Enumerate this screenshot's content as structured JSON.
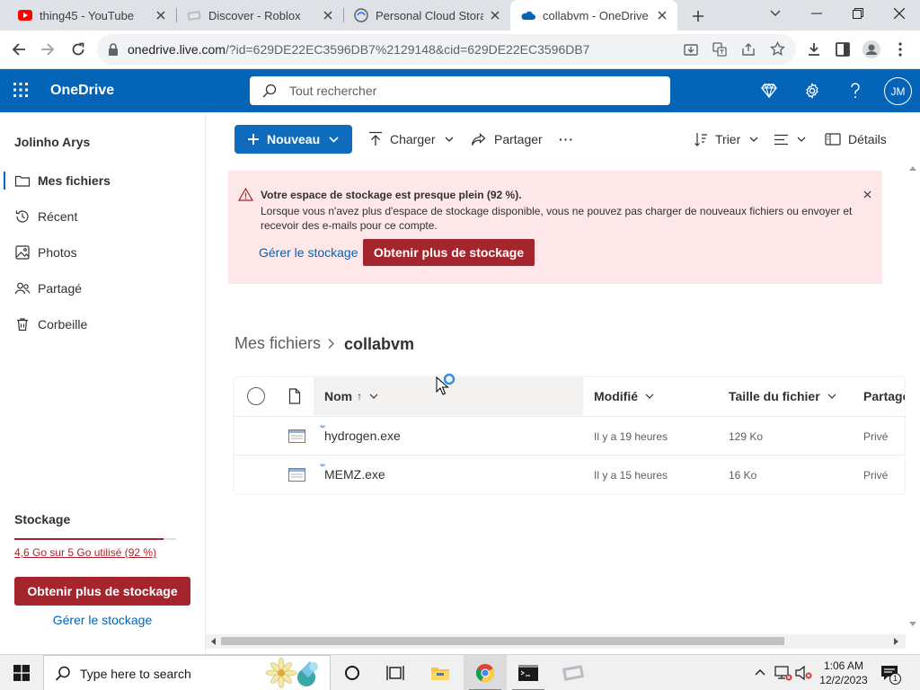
{
  "browser": {
    "tabs": [
      {
        "title": "thing45 - YouTube",
        "icon": "youtube-icon",
        "active": false
      },
      {
        "title": "Discover - Roblox",
        "icon": "roblox-icon",
        "active": false
      },
      {
        "title": "Personal Cloud Storage",
        "icon": "cloud-storage-site-icon",
        "active": false
      },
      {
        "title": "collabvm - OneDrive",
        "icon": "onedrive-icon",
        "active": true
      }
    ],
    "new_tab_icon": "plus-icon",
    "url": "onedrive.live.com/?id=629DE22EC3596DB7%2129148&cid=629DE22EC3596DB7",
    "url_host": "onedrive.live.com",
    "url_rest": "/?id=629DE22EC3596DB7%2129148&cid=629DE22EC3596DB7"
  },
  "app": {
    "name": "OneDrive",
    "search_placeholder": "Tout rechercher",
    "avatar_initials": "JM",
    "brand_color": "#0364b8"
  },
  "sidebar": {
    "user_name": "Jolinho Arys",
    "items": [
      {
        "label": "Mes fichiers",
        "icon": "folder-icon",
        "selected": true
      },
      {
        "label": "Récent",
        "icon": "history-icon",
        "selected": false
      },
      {
        "label": "Photos",
        "icon": "photo-icon",
        "selected": false
      },
      {
        "label": "Partagé",
        "icon": "people-icon",
        "selected": false
      },
      {
        "label": "Corbeille",
        "icon": "recycle-bin-icon",
        "selected": false
      }
    ],
    "storage": {
      "title": "Stockage",
      "usage_text": "4,6 Go sur 5 Go utilisé (92 %)",
      "used_fraction": 0.92,
      "upgrade_label": "Obtenir plus de stockage",
      "manage_label": "Gérer le stockage"
    }
  },
  "commandbar": {
    "new_label": "Nouveau",
    "upload_label": "Charger",
    "share_label": "Partager",
    "more_label": "···",
    "sort_label": "Trier",
    "details_label": "Détails"
  },
  "banner": {
    "title": "Votre espace de stockage est presque plein (92 %).",
    "message": "Lorsque vous n'avez plus d'espace de stockage disponible, vous ne pouvez pas charger de nouveaux fichiers ou envoyer et recevoir des e-mails pour ce compte.",
    "manage_label": "Gérer le stockage",
    "upgrade_label": "Obtenir plus de stockage",
    "color": "#a4262c"
  },
  "breadcrumb": {
    "parent": "Mes fichiers",
    "current": "collabvm"
  },
  "files": {
    "columns": {
      "name": "Nom",
      "name_sort": "↑",
      "modified": "Modifié",
      "size": "Taille du fichier",
      "sharing": "Partage"
    },
    "rows": [
      {
        "name": "hydrogen.exe",
        "modified": "Il y a 19 heures",
        "size": "129 Ko",
        "sharing": "Privé"
      },
      {
        "name": "MEMZ.exe",
        "modified": "Il y a 15 heures",
        "size": "16 Ko",
        "sharing": "Privé"
      }
    ]
  },
  "taskbar": {
    "search_placeholder": "Type here to search",
    "time": "1:06 AM",
    "date": "12/2/2023",
    "notification_count": "1"
  }
}
